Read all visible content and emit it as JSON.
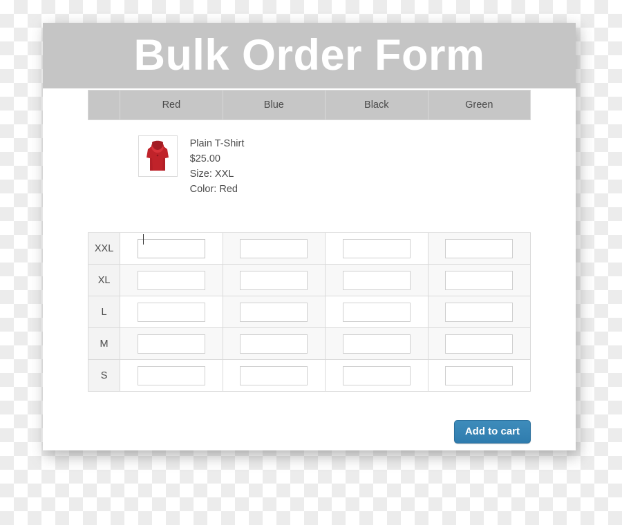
{
  "header": {
    "title": "Bulk Order Form",
    "background_color": "#c5c5c5",
    "text_color": "#ffffff"
  },
  "table": {
    "corner_header": "",
    "color_columns": [
      "Red",
      "Blue",
      "Black",
      "Green"
    ],
    "sizes": [
      "XXL",
      "XL",
      "L",
      "M",
      "S"
    ],
    "quantities": [
      [
        "",
        "",
        "",
        ""
      ],
      [
        "",
        "",
        "",
        ""
      ],
      [
        "",
        "",
        "",
        ""
      ],
      [
        "",
        "",
        "",
        ""
      ],
      [
        "",
        "",
        "",
        ""
      ]
    ],
    "quantity_placeholder": "",
    "focused_cell": {
      "size": "XXL",
      "color": "Red"
    }
  },
  "product": {
    "name": "Plain T-Shirt",
    "price": "$25.00",
    "size_line": "Size: XXL",
    "color_line": "Color: Red",
    "thumbnail_name": "red-hooded-tank-top-thumbnail",
    "thumbnail_color": "#c0232a"
  },
  "footer": {
    "add_to_cart_label": "Add to cart",
    "button_color": "#3484b5"
  }
}
